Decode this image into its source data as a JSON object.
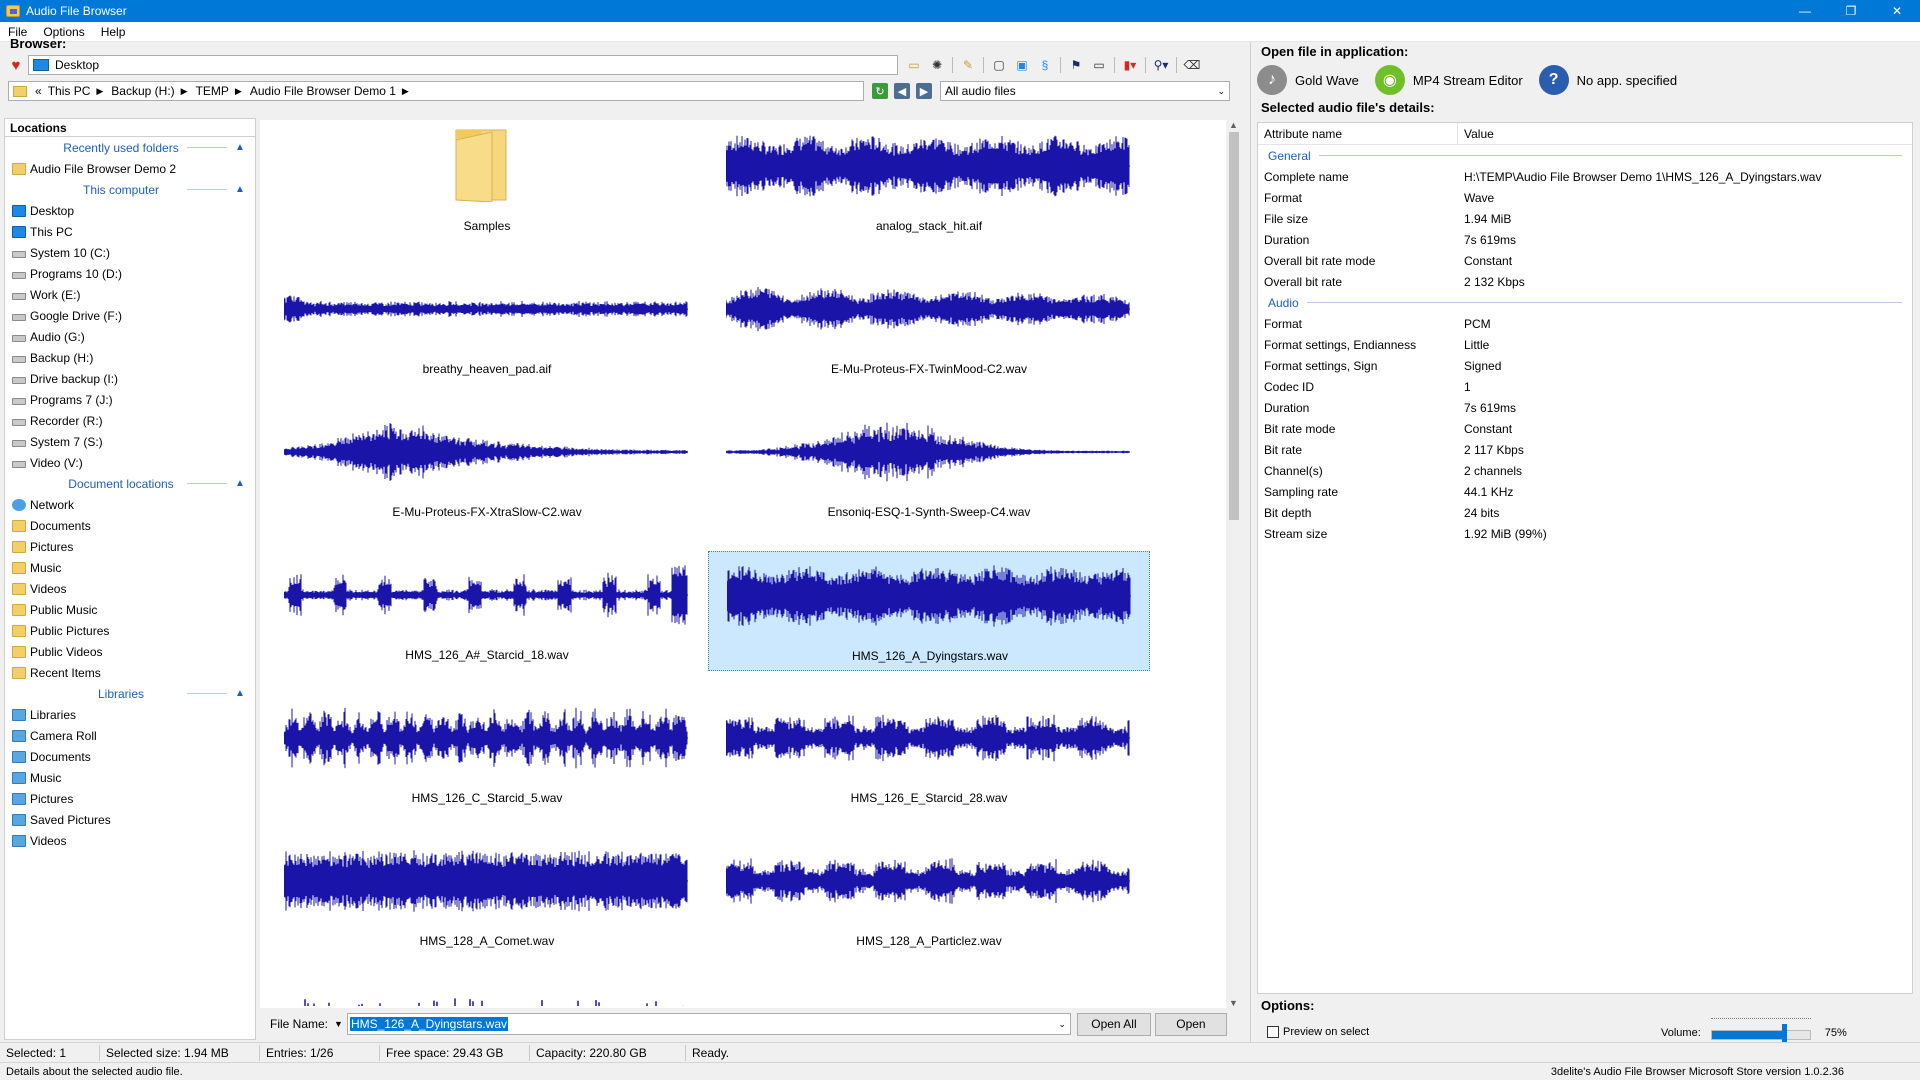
{
  "window": {
    "title": "Audio File Browser",
    "controls": [
      "—",
      "❐",
      "✕"
    ]
  },
  "menu": [
    "File",
    "Options",
    "Help"
  ],
  "browser": {
    "label": "Browser:",
    "address": "Desktop",
    "breadcrumb": [
      "«",
      "This PC",
      "Backup (H:)",
      "TEMP",
      "Audio File Browser Demo 1"
    ],
    "filter": "All audio files",
    "locations_header": "Locations",
    "groups": [
      {
        "title": "Recently used folders",
        "items": [
          {
            "label": "Audio File Browser Demo 2",
            "icon": "folder"
          }
        ]
      },
      {
        "title": "This computer",
        "items": [
          {
            "label": "Desktop",
            "icon": "monitor"
          },
          {
            "label": "This PC",
            "icon": "monitor"
          },
          {
            "label": "System 10 (C:)",
            "icon": "drive"
          },
          {
            "label": "Programs 10 (D:)",
            "icon": "drive"
          },
          {
            "label": "Work (E:)",
            "icon": "drive"
          },
          {
            "label": "Google Drive (F:)",
            "icon": "drive"
          },
          {
            "label": "Audio (G:)",
            "icon": "drive"
          },
          {
            "label": "Backup (H:)",
            "icon": "drive"
          },
          {
            "label": "Drive backup (I:)",
            "icon": "drive"
          },
          {
            "label": "Programs 7 (J:)",
            "icon": "drive"
          },
          {
            "label": "Recorder (R:)",
            "icon": "drive"
          },
          {
            "label": "System 7 (S:)",
            "icon": "drive"
          },
          {
            "label": "Video (V:)",
            "icon": "drive"
          }
        ]
      },
      {
        "title": "Document locations",
        "items": [
          {
            "label": "Network",
            "icon": "network"
          },
          {
            "label": "Documents",
            "icon": "folder"
          },
          {
            "label": "Pictures",
            "icon": "folder"
          },
          {
            "label": "Music",
            "icon": "folder"
          },
          {
            "label": "Videos",
            "icon": "folder"
          },
          {
            "label": "Public Music",
            "icon": "folder"
          },
          {
            "label": "Public Pictures",
            "icon": "folder"
          },
          {
            "label": "Public Videos",
            "icon": "folder"
          },
          {
            "label": "Recent Items",
            "icon": "folder"
          }
        ]
      },
      {
        "title": "Libraries",
        "items": [
          {
            "label": "Libraries",
            "icon": "library"
          },
          {
            "label": "Camera Roll",
            "icon": "library"
          },
          {
            "label": "Documents",
            "icon": "library"
          },
          {
            "label": "Music",
            "icon": "library"
          },
          {
            "label": "Pictures",
            "icon": "library"
          },
          {
            "label": "Saved Pictures",
            "icon": "library"
          },
          {
            "label": "Videos",
            "icon": "library"
          }
        ]
      }
    ],
    "files": [
      {
        "name": "Samples",
        "type": "folder"
      },
      {
        "name": "analog_stack_hit.aif",
        "type": "audio",
        "wave": "dense"
      },
      {
        "name": "breathy_heaven_pad.aif",
        "type": "audio",
        "wave": "thin"
      },
      {
        "name": "E-Mu-Proteus-FX-TwinMood-C2.wav",
        "type": "audio",
        "wave": "bumpy"
      },
      {
        "name": "E-Mu-Proteus-FX-XtraSlow-C2.wav",
        "type": "audio",
        "wave": "swell"
      },
      {
        "name": "Ensoniq-ESQ-1-Synth-Sweep-C4.wav",
        "type": "audio",
        "wave": "diamond"
      },
      {
        "name": "HMS_126_A#_Starcid_18.wav",
        "type": "audio",
        "wave": "pulses"
      },
      {
        "name": "HMS_126_A_Dyingstars.wav",
        "type": "audio",
        "wave": "dense",
        "selected": true
      },
      {
        "name": "HMS_126_C_Starcid_5.wav",
        "type": "audio",
        "wave": "spiky"
      },
      {
        "name": "HMS_126_E_Starcid_28.wav",
        "type": "audio",
        "wave": "blocks"
      },
      {
        "name": "HMS_128_A_Comet.wav",
        "type": "audio",
        "wave": "loud"
      },
      {
        "name": "HMS_128_A_Particlez.wav",
        "type": "audio",
        "wave": "blocks"
      }
    ],
    "file_name_label": "File Name:",
    "file_name_value": "HMS_126_A_Dyingstars.wav",
    "open_all_label": "Open All",
    "open_label": "Open"
  },
  "right": {
    "open_label": "Open file in application:",
    "apps": [
      {
        "name": "Gold Wave",
        "icon": "goldwave-icon",
        "color": "#7a7a7a"
      },
      {
        "name": "MP4 Stream Editor",
        "icon": "mp4-editor-icon",
        "color": "#6fbf2a"
      },
      {
        "name": "No app. specified",
        "icon": "question-icon",
        "color": "#2a5db0"
      }
    ],
    "details_label": "Selected audio file's details:",
    "col_attr": "Attribute name",
    "col_value": "Value",
    "sections": [
      {
        "title": "General",
        "rows": [
          [
            "Complete name",
            "H:\\TEMP\\Audio File Browser Demo 1\\HMS_126_A_Dyingstars.wav"
          ],
          [
            "Format",
            "Wave"
          ],
          [
            "File size",
            "1.94 MiB"
          ],
          [
            "Duration",
            "7s 619ms"
          ],
          [
            "Overall bit rate mode",
            "Constant"
          ],
          [
            "Overall bit rate",
            "2 132 Kbps"
          ]
        ]
      },
      {
        "title": "Audio",
        "rows": [
          [
            "Format",
            "PCM"
          ],
          [
            "Format settings, Endianness",
            "Little"
          ],
          [
            "Format settings, Sign",
            "Signed"
          ],
          [
            "Codec ID",
            "1"
          ],
          [
            "Duration",
            "7s 619ms"
          ],
          [
            "Bit rate mode",
            "Constant"
          ],
          [
            "Bit rate",
            "2 117 Kbps"
          ],
          [
            "Channel(s)",
            "2 channels"
          ],
          [
            "Sampling rate",
            "44.1 KHz"
          ],
          [
            "Bit depth",
            "24 bits"
          ],
          [
            "Stream size",
            "1.92 MiB (99%)"
          ]
        ]
      }
    ],
    "options_label": "Options:",
    "preview_label": "Preview on select",
    "volume_label": "Volume:",
    "volume_text": "75%",
    "volume_value": 0.75
  },
  "status": {
    "cells": [
      "Selected: 1",
      "Selected size: 1.94 MB",
      "Entries: 1/26",
      "Free space: 29.43 GB",
      "Capacity: 220.80 GB",
      "Ready."
    ],
    "hint": "Details about the selected audio file.",
    "version": "3delite's Audio File Browser Microsoft Store version 1.0.2.36"
  },
  "colors": {
    "wave": "#1a14a8",
    "accent": "#0078d7",
    "selection": "#cce8ff"
  }
}
